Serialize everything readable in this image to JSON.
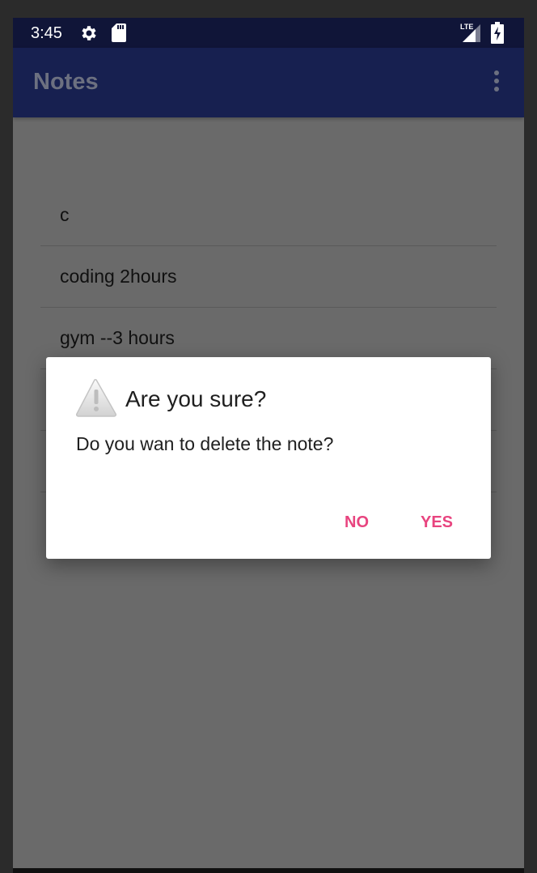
{
  "status_bar": {
    "time": "3:45",
    "icons": [
      "settings-gear-icon",
      "sd-card-icon",
      "lte-signal-icon",
      "battery-charging-icon"
    ],
    "network_label": "LTE"
  },
  "app_bar": {
    "title": "Notes",
    "overflow_icon": "more-vert-icon",
    "background": "#172050"
  },
  "notes": [
    {
      "text": "c"
    },
    {
      "text": "coding 2hours"
    },
    {
      "text": "gym --3 hours"
    },
    {
      "text": ""
    },
    {
      "text": ""
    }
  ],
  "dialog": {
    "icon": "warning-icon",
    "title": "Are you sure?",
    "message": "Do you wan to delete the note?",
    "buttons": {
      "no_label": "NO",
      "yes_label": "YES"
    },
    "button_color": "#e8447f"
  }
}
